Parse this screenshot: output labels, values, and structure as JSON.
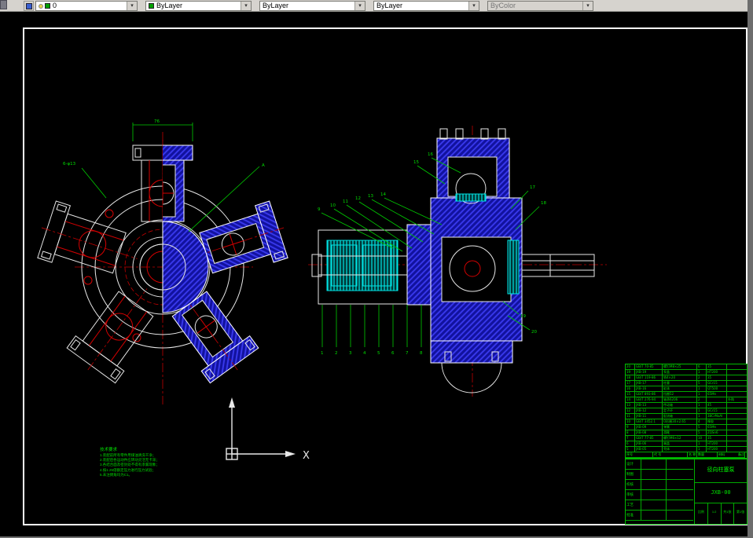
{
  "colors": {
    "section_blue": "#2222cc",
    "centerline_red": "#c00000",
    "annotation_green": "#00dd00",
    "detail_cyan": "#00e5e5",
    "outline_white": "#e8e8e8",
    "toolbar_gray": "#d6d3ce"
  },
  "toolbar": {
    "layer_value": "0",
    "color_value": "ByLayer",
    "linetype_value": "ByLayer",
    "lineweight_value": "ByLayer",
    "plotstyle_value": "ByColor",
    "dropdown_icon": "▾"
  },
  "ucs": {
    "x_label": "X"
  },
  "left_view_labels": {
    "top_dim": "76",
    "leader": "A",
    "bolt_note": "6-φ13"
  },
  "callouts": {
    "bottom": [
      "1",
      "2",
      "3",
      "4",
      "5",
      "6",
      "7",
      "8"
    ],
    "upper_left": [
      "9",
      "10",
      "11",
      "12",
      "13",
      "14"
    ],
    "top": [
      "15",
      "16"
    ],
    "right": [
      "17",
      "18"
    ],
    "lower_right": [
      "19",
      "20"
    ]
  },
  "notes": {
    "title": "技术要求",
    "lines": [
      "1.装配前所有零件用煤油清洗干净；",
      "2.装配后各运动件应转动灵活无卡滞；",
      "3.各结合面及密封处不得有渗漏现象；",
      "4.按1.25倍额定压力进行压力试验；",
      "5.未注倒角均为C1。"
    ]
  },
  "bom": {
    "headers": [
      "序号",
      "代  号",
      "名  称",
      "数量",
      "材料",
      "备注"
    ],
    "rows": [
      [
        "20",
        "GB/T 70-85",
        "螺钉M8×25",
        "6",
        "35",
        ""
      ],
      [
        "19",
        "JXB-19",
        "泵盖",
        "1",
        "HT200",
        ""
      ],
      [
        "18",
        "GB/T 119-86",
        "销4×20",
        "2",
        "35",
        ""
      ],
      [
        "17",
        "JXB-17",
        "柱塞",
        "5",
        "GCr15",
        ""
      ],
      [
        "16",
        "JXB-16",
        "缸体",
        "1",
        "QT500",
        ""
      ],
      [
        "15",
        "GB/T 893-86",
        "挡圈52",
        "1",
        "65Mn",
        ""
      ],
      [
        "14",
        "GB/T 276-94",
        "轴承6206",
        "2",
        "",
        "外购"
      ],
      [
        "13",
        "JXB-13",
        "传动轴",
        "1",
        "45",
        ""
      ],
      [
        "12",
        "JXB-12",
        "定子环",
        "1",
        "GCr15",
        ""
      ],
      [
        "11",
        "JXB-11",
        "配流轴",
        "1",
        "38CrMoAl",
        ""
      ],
      [
        "10",
        "GB/T 3452.1",
        "O形圈30×2.65",
        "4",
        "橡胶",
        ""
      ],
      [
        "9",
        "JXB-09",
        "弹簧",
        "5",
        "65Mn",
        ""
      ],
      [
        "8",
        "JXB-08",
        "滑靴",
        "5",
        "ZQSn6",
        ""
      ],
      [
        "7",
        "GB/T 77-85",
        "螺钉M6×12",
        "10",
        "35",
        ""
      ],
      [
        "6",
        "JXB-06",
        "端盖",
        "1",
        "HT200",
        ""
      ],
      [
        "5",
        "JXB-05",
        "壳体",
        "1",
        "HT200",
        ""
      ]
    ]
  },
  "titleblock": {
    "labels": [
      "设计",
      "制图",
      "校核",
      "审核",
      "工艺",
      "批准"
    ],
    "title": "径向柱塞泵",
    "code": "JXB-00",
    "scale_label": "比例",
    "scale_value": "1:2",
    "sheet": "共1张",
    "page": "第1张"
  }
}
